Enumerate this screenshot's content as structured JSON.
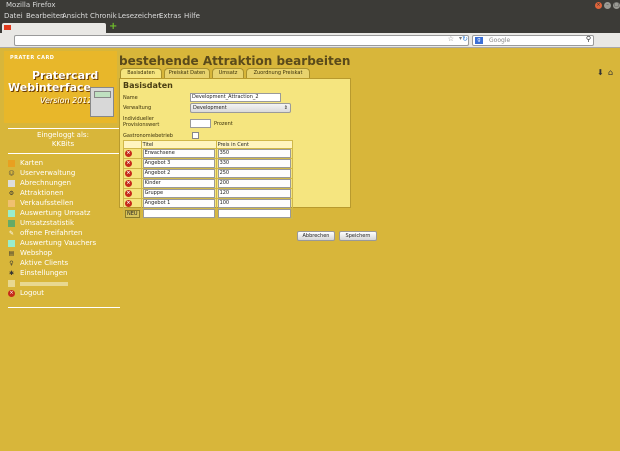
{
  "window": {
    "title": "Mozilla Firefox"
  },
  "menu": [
    "Datei",
    "Bearbeiten",
    "Ansicht",
    "Chronik",
    "Lesezeichen",
    "Extras",
    "Hilfe"
  ],
  "navbar": {
    "search_placeholder": "Google"
  },
  "logo": {
    "ribbon": "PRATER CARD",
    "line1": "Pratercard",
    "line2": "Webinterface",
    "line3": "Version 2012"
  },
  "login": {
    "line1": "Eingeloggt als:",
    "line2": "KKBits"
  },
  "sidebar": {
    "items": [
      {
        "label": "Karten",
        "icon": "cards-icon"
      },
      {
        "label": "Userverwaltung",
        "icon": "user-icon"
      },
      {
        "label": "Abrechnungen",
        "icon": "billing-icon"
      },
      {
        "label": "Attraktionen",
        "icon": "attraction-icon"
      },
      {
        "label": "Verkaufsstellen",
        "icon": "shop-icon"
      },
      {
        "label": "Auswertung Umsatz",
        "icon": "chart-icon"
      },
      {
        "label": "Umsatzstatistik",
        "icon": "stats-icon"
      },
      {
        "label": "offene Freifahrten",
        "icon": "ticket-icon"
      },
      {
        "label": "Auswertung Vauchers",
        "icon": "voucher-icon"
      },
      {
        "label": "Webshop",
        "icon": "cart-icon"
      },
      {
        "label": "Aktive Clients",
        "icon": "clients-icon"
      },
      {
        "label": "Einstellungen",
        "icon": "settings-icon"
      },
      {
        "label": "",
        "icon": "blurred-icon"
      },
      {
        "label": "Logout",
        "icon": "logout-icon"
      }
    ]
  },
  "page": {
    "title": "bestehende Attraktion bearbeiten",
    "tabs": [
      "Basisdaten",
      "Preiskat Daten",
      "Umsatz",
      "Zuordnung Preiskat"
    ],
    "panel_heading": "Basisdaten",
    "fields": {
      "name_label": "Name",
      "name_value": "Development_Attraction_2",
      "verwaltung_label": "Verwaltung",
      "verwaltung_value": "Development",
      "provision_label": "Individueller Provisionswert",
      "provision_unit": "Prozent",
      "gastro_label": "Gastronomiebetrieb"
    },
    "table": {
      "headers": [
        "Titel",
        "Preis in Cent"
      ],
      "rows": [
        {
          "titel": "Erwachsene",
          "preis": "350"
        },
        {
          "titel": "Angebot 3",
          "preis": "330"
        },
        {
          "titel": "Angebot 2",
          "preis": "250"
        },
        {
          "titel": "Kinder",
          "preis": "200"
        },
        {
          "titel": "Gruppe",
          "preis": "120"
        },
        {
          "titel": "Angebot 1",
          "preis": "100"
        }
      ],
      "new_label": "NEU"
    },
    "buttons": {
      "cancel": "Abbrechen",
      "save": "Speichern"
    }
  }
}
